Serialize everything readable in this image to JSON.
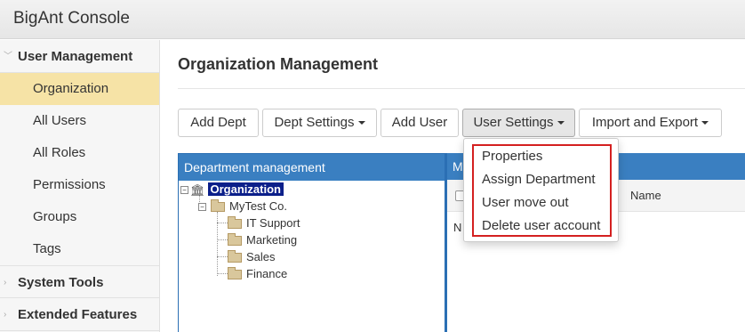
{
  "app": {
    "title": "BigAnt Console"
  },
  "sidebar": {
    "sections": [
      {
        "label": "User Management",
        "expanded": true
      },
      {
        "label": "System Tools",
        "expanded": false
      },
      {
        "label": "Extended Features",
        "expanded": false
      }
    ],
    "items": [
      {
        "label": "Organization",
        "active": true
      },
      {
        "label": "All Users"
      },
      {
        "label": "All Roles"
      },
      {
        "label": "Permissions"
      },
      {
        "label": "Groups"
      },
      {
        "label": "Tags"
      }
    ]
  },
  "main": {
    "title": "Organization Management",
    "toolbar": {
      "add_dept": "Add Dept",
      "dept_settings": "Dept Settings",
      "add_user": "Add User",
      "user_settings": "User Settings",
      "import_export": "Import and Export"
    },
    "dept_panel": {
      "title": "Department management",
      "tree": {
        "root": "Organization",
        "company": "MyTest Co.",
        "departments": [
          "IT Support",
          "Marketing",
          "Sales",
          "Finance"
        ]
      }
    },
    "right_panel": {
      "title_prefix": "M",
      "column_name": "Name",
      "row_prefix": "N"
    }
  },
  "user_settings_menu": {
    "items": [
      "Properties",
      "Assign Department",
      "User move out",
      "Delete user account"
    ]
  },
  "colors": {
    "panel_header": "#3a7fc1",
    "active_item": "#f6e3a6",
    "selected_node": "#0b1f8a",
    "highlight_border": "#d42020"
  }
}
